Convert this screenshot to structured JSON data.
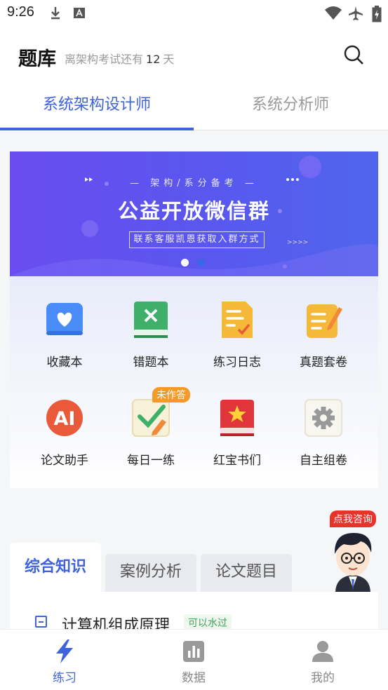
{
  "status_bar": {
    "time": "9:26"
  },
  "header": {
    "title": "题库",
    "subtitle_prefix": "离架构考试还有",
    "days": "12",
    "subtitle_suffix": "天"
  },
  "tabs": [
    {
      "label": "系统架构设计师",
      "active": true
    },
    {
      "label": "系统分析师",
      "active": false
    }
  ],
  "banner": {
    "small_text": "— 架构/系分备考 —",
    "title": "公益开放微信群",
    "button": "联系客服凯恩获取入群方式",
    "dots": 2,
    "active_dot": 0
  },
  "grid": [
    {
      "label": "收藏本",
      "icon": "heart-book-icon",
      "color": "#4a8cf7"
    },
    {
      "label": "错题本",
      "icon": "wrong-book-icon",
      "color": "#3fb06a"
    },
    {
      "label": "练习日志",
      "icon": "practice-log-icon",
      "color": "#f5b93a"
    },
    {
      "label": "真题套卷",
      "icon": "exam-paper-icon",
      "color": "#f5b93a"
    },
    {
      "label": "论文助手",
      "icon": "ai-assistant-icon",
      "color": "#e85a3a",
      "icon_text": "AI"
    },
    {
      "label": "每日一练",
      "icon": "daily-practice-icon",
      "color": "#3fb06a",
      "badge": "未作答"
    },
    {
      "label": "红宝书们",
      "icon": "red-book-icon",
      "color": "#e0353a"
    },
    {
      "label": "自主组卷",
      "icon": "gear-icon",
      "color": "#999999"
    }
  ],
  "consult": {
    "label": "点我咨询"
  },
  "sub_tabs": [
    {
      "label": "综合知识",
      "active": true
    },
    {
      "label": "案例分析",
      "active": false
    },
    {
      "label": "论文题目",
      "active": false
    }
  ],
  "list": [
    {
      "title": "计算机组成原理",
      "tag": "可以水过"
    }
  ],
  "bottom_nav": [
    {
      "label": "练习",
      "icon": "lightning-icon",
      "active": true
    },
    {
      "label": "数据",
      "icon": "bar-chart-icon",
      "active": false
    },
    {
      "label": "我的",
      "icon": "user-icon",
      "active": false
    }
  ],
  "colors": {
    "accent": "#3e63dd",
    "banner_start": "#6a4cf0",
    "banner_end": "#4f66ec"
  }
}
